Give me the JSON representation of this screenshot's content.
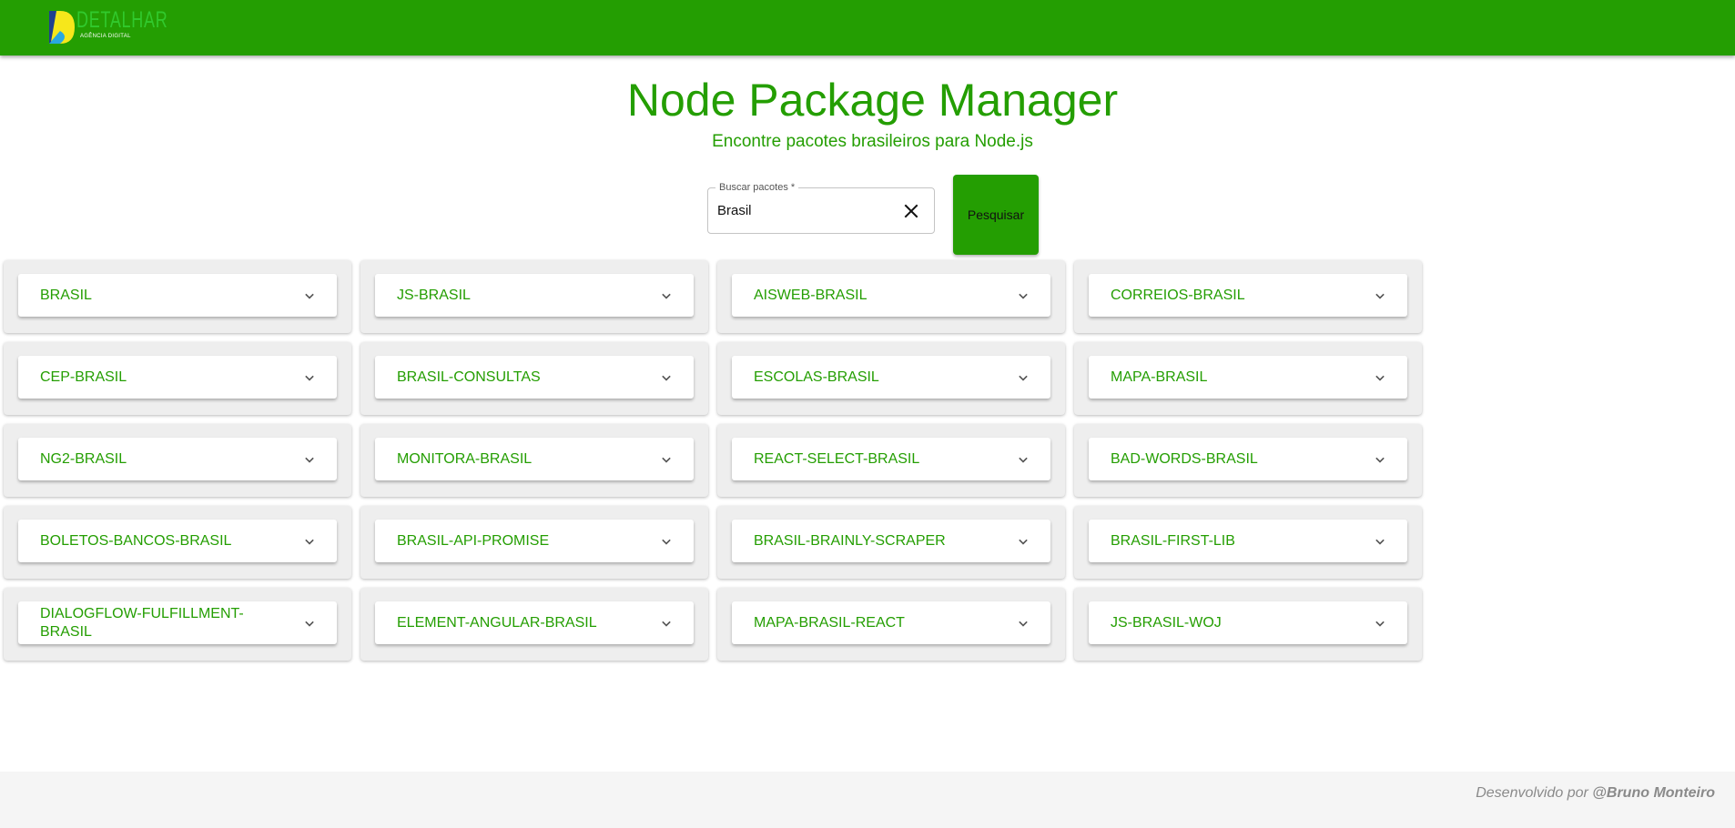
{
  "header": {
    "logo_title": "DETALHAR",
    "logo_subtitle": "AGÊNCIA DIGITAL",
    "bar_color": "#249e02"
  },
  "main": {
    "title": "Node Package Manager",
    "subtitle": "Encontre pacotes brasileiros para Node.js"
  },
  "search": {
    "label": "Buscar pacotes *",
    "value": "Brasil",
    "clear_icon": "close-icon",
    "button_label": "Pesquisar"
  },
  "packages": [
    "BRASIL",
    "JS-BRASIL",
    "AISWEB-BRASIL",
    "CORREIOS-BRASIL",
    "CEP-BRASIL",
    "BRASIL-CONSULTAS",
    "ESCOLAS-BRASIL",
    "MAPA-BRASIL",
    "NG2-BRASIL",
    "MONITORA-BRASIL",
    "REACT-SELECT-BRASIL",
    "BAD-WORDS-BRASIL",
    "BOLETOS-BANCOS-BRASIL",
    "BRASIL-API-PROMISE",
    "BRASIL-BRAINLY-SCRAPER",
    "BRASIL-FIRST-LIB",
    "DIALOGFLOW-FULFILLMENT-BRASIL",
    "ELEMENT-ANGULAR-BRASIL",
    "MAPA-BRASIL-REACT",
    "JS-BRASIL-WOJ"
  ],
  "package_icon": "chevron-down-icon",
  "footer": {
    "prefix": "Desenvolvido por ",
    "author": "@Bruno Monteiro"
  },
  "colors": {
    "accent": "#249e02",
    "footer_bg": "#f5f5f5",
    "cell_bg": "#eeeeee"
  }
}
